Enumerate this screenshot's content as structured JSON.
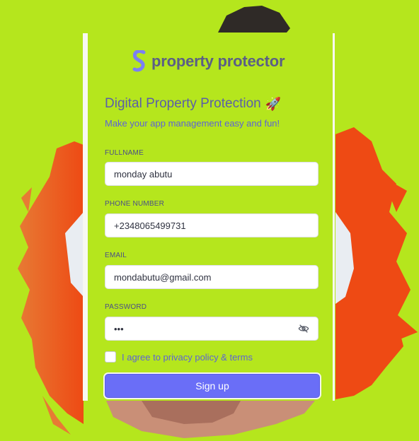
{
  "brand": {
    "name": "property protector",
    "logo_icon": "brand-s-icon",
    "logo_color": "#7b7ff5"
  },
  "form": {
    "title": "Digital Property Protection",
    "title_emoji": "🚀",
    "subtitle": "Make your app management easy and fun!",
    "fields": {
      "fullname": {
        "label": "FULLNAME",
        "value": "monday abutu"
      },
      "phone": {
        "label": "PHONE NUMBER",
        "value": "+2348065499731"
      },
      "email": {
        "label": "EMAIL",
        "value": "mondabutu@gmail.com"
      },
      "password": {
        "label": "PASSWORD",
        "value": "•••",
        "toggle_icon": "eye-off-icon"
      }
    },
    "agree": {
      "prefix": "I agree to ",
      "link": "privacy policy & terms",
      "checked": false
    },
    "submit_label": "Sign up"
  },
  "colors": {
    "background": "#b5e61d",
    "accent": "#6a6ef7",
    "splash": "#ee5a22"
  }
}
